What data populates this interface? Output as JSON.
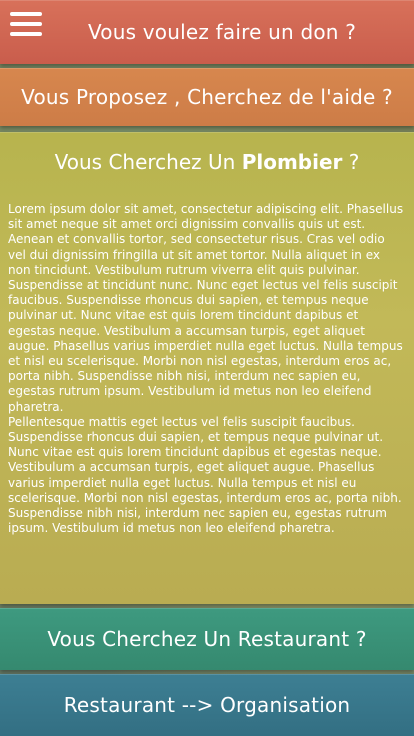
{
  "menu": {
    "icon": "hamburger-menu-icon"
  },
  "donate": {
    "title": "Vous voulez faire un don ?",
    "color": "#cd624f"
  },
  "propose": {
    "title": "Vous Proposez , Cherchez de l'aide ?",
    "color": "#d2804a"
  },
  "search": {
    "heading_prefix": "Vous Cherchez Un ",
    "heading_bold": "Plombier",
    "heading_suffix": " ?",
    "color": "#bcb653",
    "paragraphs": [
      "Lorem ipsum dolor sit amet, consectetur adipiscing elit. Phasellus sit amet neque sit amet orci dignissim convallis quis ut est. Aenean et convallis tortor, sed consectetur risus. Cras vel odio vel dui dignissim fringilla ut sit amet tortor. Nulla aliquet in ex non tincidunt. Vestibulum rutrum viverra elit quis pulvinar. Suspendisse at tincidunt nunc. Nunc eget lectus vel felis suscipit faucibus. Suspendisse rhoncus dui sapien, et tempus neque pulvinar ut. Nunc vitae est quis lorem tincidunt dapibus et egestas neque. Vestibulum a accumsan turpis, eget aliquet augue. Phasellus varius imperdiet nulla eget luctus. Nulla tempus et nisl eu scelerisque. Morbi non nisl egestas, interdum eros ac, porta nibh. Suspendisse nibh nisi, interdum nec sapien eu, egestas rutrum ipsum. Vestibulum id metus non leo eleifend pharetra.",
      "Pellentesque mattis eget lectus vel felis suscipit faucibus. Suspendisse rhoncus dui sapien, et tempus neque pulvinar ut. Nunc vitae est quis lorem tincidunt dapibus et egestas neque. Vestibulum a accumsan turpis, eget aliquet augue. Phasellus varius imperdiet nulla eget luctus. Nulla tempus et nisl eu scelerisque. Morbi non nisl egestas, interdum eros ac, porta nibh. Suspendisse nibh nisi, interdum nec sapien eu, egestas rutrum ipsum. Vestibulum id metus non leo eleifend pharetra."
    ]
  },
  "restaurant": {
    "title": "Vous Cherchez Un Restaurant ?",
    "color": "#3a917a"
  },
  "organisation": {
    "title": "Restaurant --> Organisation",
    "color": "#38788c"
  }
}
